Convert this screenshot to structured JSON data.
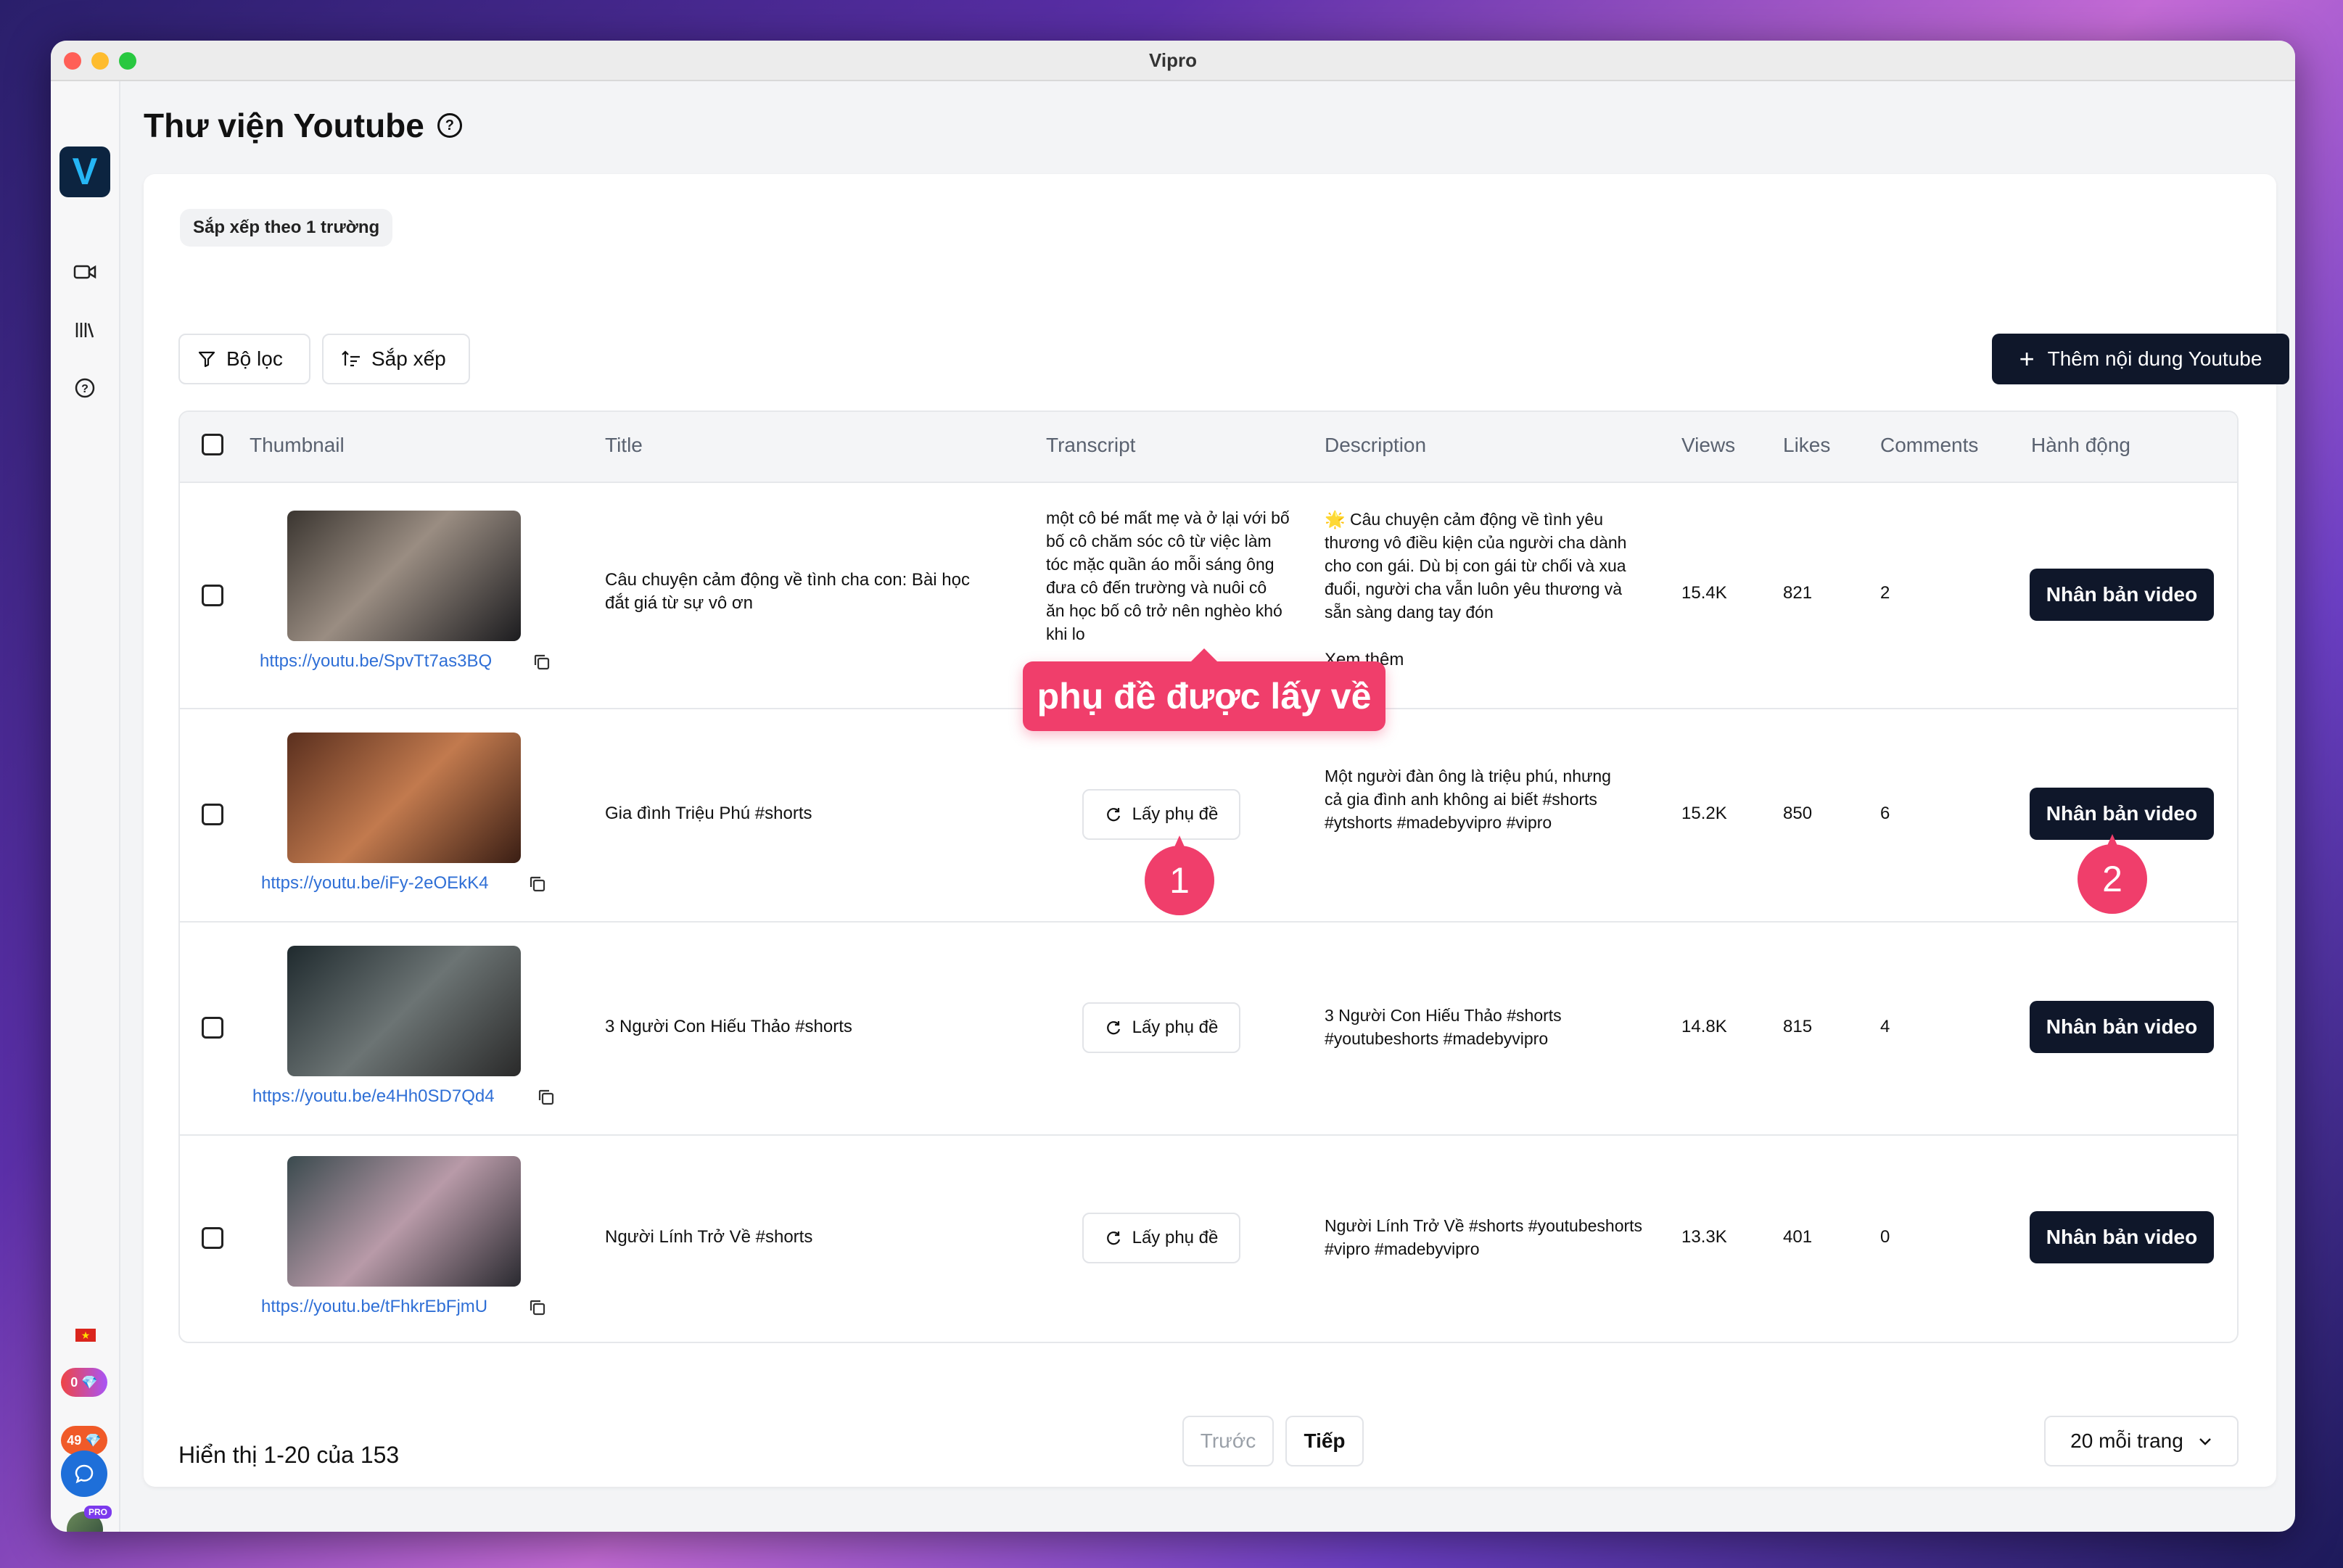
{
  "window": {
    "title": "Vipro"
  },
  "sidebar": {
    "logo": "V",
    "icons": [
      "video-camera-icon",
      "library-icon",
      "help-icon"
    ],
    "flag": "★",
    "badge_gems": "0",
    "badge_points": "49",
    "pro_label": "PRO"
  },
  "page": {
    "title": "Thư viện Youtube"
  },
  "chip": {
    "label": "Sắp xếp theo 1 trường"
  },
  "toolbar": {
    "filter_label": "Bộ lọc",
    "sort_label": "Sắp xếp",
    "add_label": "Thêm nội dung Youtube"
  },
  "table": {
    "headers": [
      "Thumbnail",
      "Title",
      "Transcript",
      "Description",
      "Views",
      "Likes",
      "Comments",
      "Hành động"
    ],
    "rows": [
      {
        "link": "https://youtu.be/SpvTt7as3BQ",
        "title": "Câu chuyện cảm động về tình cha con: Bài học đắt giá từ sự vô ơn",
        "transcript": "một cô bé mất mẹ và ở lại với bố bố cô chăm sóc cô từ việc làm tóc mặc quần áo mỗi sáng ông đưa cô đến trường và nuôi cô ăn học bố cô trở nên nghèo khó khi lo",
        "description": "🌟 Câu chuyện cảm động về tình yêu thương vô điều kiện của người cha dành cho con gái. Dù bị con gái từ chối và xua đuổi, người cha vẫn luôn yêu thương và sẵn sàng dang tay đón",
        "see_more": "Xem thêm",
        "views": "15.4K",
        "likes": "821",
        "comments": "2",
        "action": "Nhân bản video"
      },
      {
        "link": "https://youtu.be/iFy-2eOEkK4",
        "title": "Gia đình Triệu Phú #shorts",
        "transcript_button": "Lấy phụ đề",
        "description": "Một người đàn ông là triệu phú, nhưng cả gia đình anh không ai biết #shorts #ytshorts #madebyvipro #vipro",
        "views": "15.2K",
        "likes": "850",
        "comments": "6",
        "action": "Nhân bản video"
      },
      {
        "link": "https://youtu.be/e4Hh0SD7Qd4",
        "title": "3 Người Con Hiếu Thảo #shorts",
        "transcript_button": "Lấy phụ đề",
        "description": "3 Người Con Hiếu Thảo #shorts #youtubeshorts #madebyvipro",
        "views": "14.8K",
        "likes": "815",
        "comments": "4",
        "action": "Nhân bản video"
      },
      {
        "link": "https://youtu.be/tFhkrEbFjmU",
        "title": "Người Lính Trở Về #shorts",
        "transcript_button": "Lấy phụ đề",
        "description": "Người Lính Trở Về #shorts #youtubeshorts #vipro #madebyvipro",
        "views": "13.3K",
        "likes": "401",
        "comments": "0",
        "action": "Nhân bản video"
      }
    ]
  },
  "annotations": {
    "callout": "phụ đề được lấy về",
    "bubble1": "1",
    "bubble2": "2"
  },
  "footer": {
    "showing": "Hiển thị 1-20 của 153",
    "prev": "Trước",
    "next": "Tiếp",
    "per_page": "20 mỗi trang"
  },
  "colors": {
    "accent": "#f03e6b",
    "primary_dark": "#0f172a",
    "link": "#2f6fd6"
  }
}
